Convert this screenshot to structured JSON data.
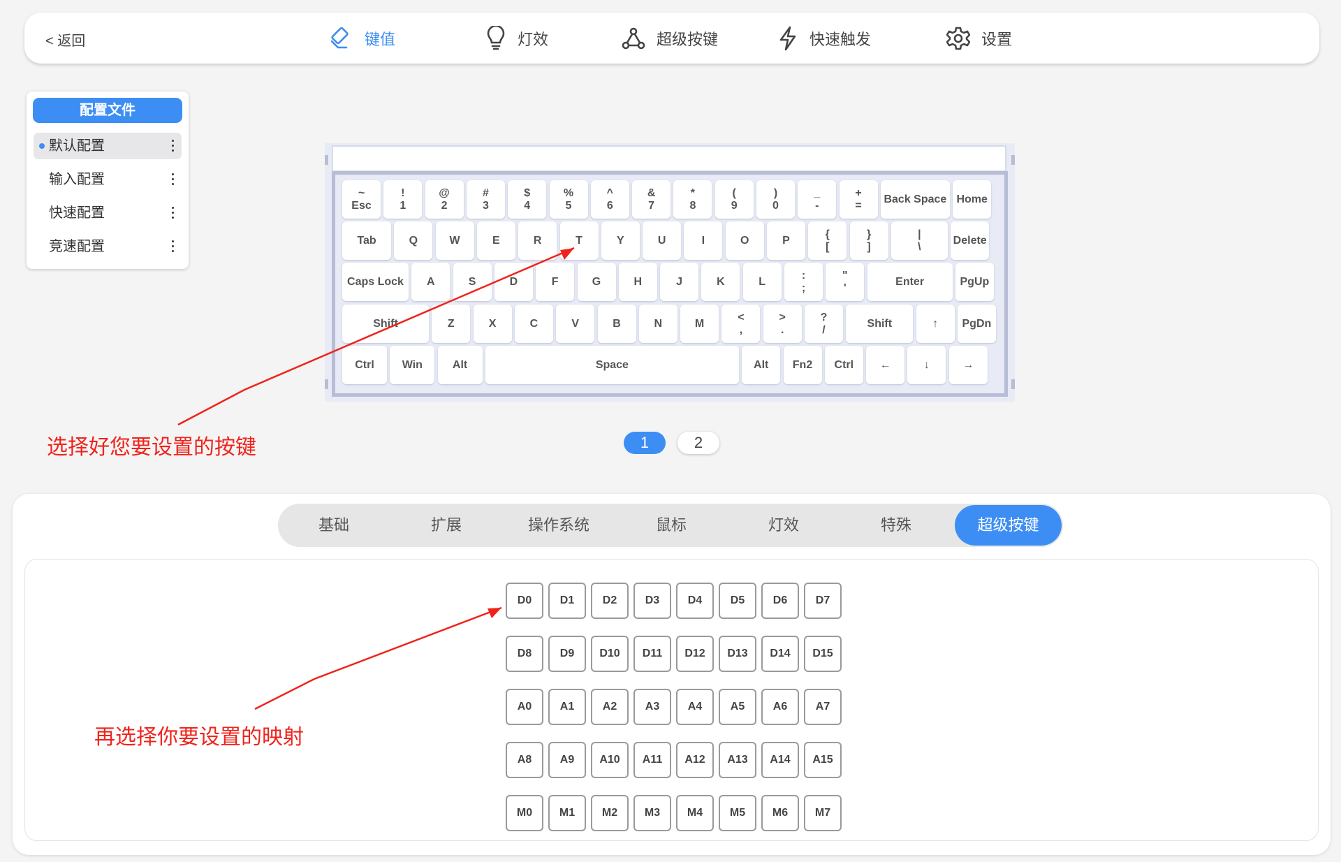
{
  "topbar": {
    "back": "< 返回",
    "nav": [
      {
        "label": "键值",
        "icon": "edit-key-icon"
      },
      {
        "label": "灯效",
        "icon": "bulb-icon"
      },
      {
        "label": "超级按键",
        "icon": "network-icon"
      },
      {
        "label": "快速触发",
        "icon": "lightning-icon"
      },
      {
        "label": "设置",
        "icon": "gear-icon"
      }
    ],
    "active": "键值",
    "accent": "#3a8ef0"
  },
  "profiles": {
    "title": "配置文件",
    "items": [
      "默认配置",
      "输入配置",
      "快速配置",
      "竞速配置"
    ],
    "selected": "默认配置"
  },
  "keyboard": {
    "rows": [
      [
        [
          "~",
          "Esc"
        ],
        [
          "!",
          "1"
        ],
        [
          "@",
          "2"
        ],
        [
          "#",
          "3"
        ],
        [
          "$",
          "4"
        ],
        [
          "%",
          "5"
        ],
        [
          "^",
          "6"
        ],
        [
          "&",
          "7"
        ],
        [
          "*",
          "8"
        ],
        [
          "(",
          "9"
        ],
        [
          ")",
          "0"
        ],
        [
          "_",
          "-"
        ],
        [
          "+",
          "="
        ],
        [
          "Back Space"
        ],
        [
          "Home"
        ]
      ],
      [
        [
          "Tab"
        ],
        [
          "Q"
        ],
        [
          "W"
        ],
        [
          "E"
        ],
        [
          "R"
        ],
        [
          "T"
        ],
        [
          "Y"
        ],
        [
          "U"
        ],
        [
          "I"
        ],
        [
          "O"
        ],
        [
          "P"
        ],
        [
          "{",
          "["
        ],
        [
          "}",
          "]"
        ],
        [
          "|",
          "\\"
        ],
        [
          "Delete"
        ]
      ],
      [
        [
          "Caps Lock"
        ],
        [
          "A"
        ],
        [
          "S"
        ],
        [
          "D"
        ],
        [
          "F"
        ],
        [
          "G"
        ],
        [
          "H"
        ],
        [
          "J"
        ],
        [
          "K"
        ],
        [
          "L"
        ],
        [
          ":",
          ";"
        ],
        [
          "\"",
          "'"
        ],
        [
          "Enter"
        ],
        [
          "PgUp"
        ]
      ],
      [
        [
          "Shift"
        ],
        [
          "Z"
        ],
        [
          "X"
        ],
        [
          "C"
        ],
        [
          "V"
        ],
        [
          "B"
        ],
        [
          "N"
        ],
        [
          "M"
        ],
        [
          "<",
          ","
        ],
        [
          ">",
          "."
        ],
        [
          "?",
          "/"
        ],
        [
          "Shift"
        ],
        [
          "↑"
        ],
        [
          "PgDn"
        ]
      ],
      [
        [
          "Ctrl"
        ],
        [
          "Win"
        ],
        [
          "Alt"
        ],
        [
          "Space"
        ],
        [
          "Alt"
        ],
        [
          "Fn2"
        ],
        [
          "Ctrl"
        ],
        [
          "←"
        ],
        [
          "↓"
        ],
        [
          "→"
        ]
      ]
    ]
  },
  "pager": {
    "pages": [
      "1",
      "2"
    ],
    "current": "1"
  },
  "annotations": {
    "select_key": "选择好您要设置的按键",
    "select_mapping": "再选择你要设置的映射",
    "color": "#f0231b"
  },
  "mapping": {
    "tabs": [
      "基础",
      "扩展",
      "操作系统",
      "鼠标",
      "灯效",
      "特殊",
      "超级按键"
    ],
    "active_tab": "超级按键",
    "grid": [
      [
        "D0",
        "D1",
        "D2",
        "D3",
        "D4",
        "D5",
        "D6",
        "D7"
      ],
      [
        "D8",
        "D9",
        "D10",
        "D11",
        "D12",
        "D13",
        "D14",
        "D15"
      ],
      [
        "A0",
        "A1",
        "A2",
        "A3",
        "A4",
        "A5",
        "A6",
        "A7"
      ],
      [
        "A8",
        "A9",
        "A10",
        "A11",
        "A12",
        "A13",
        "A14",
        "A15"
      ],
      [
        "M0",
        "M1",
        "M2",
        "M3",
        "M4",
        "M5",
        "M6",
        "M7"
      ]
    ]
  }
}
